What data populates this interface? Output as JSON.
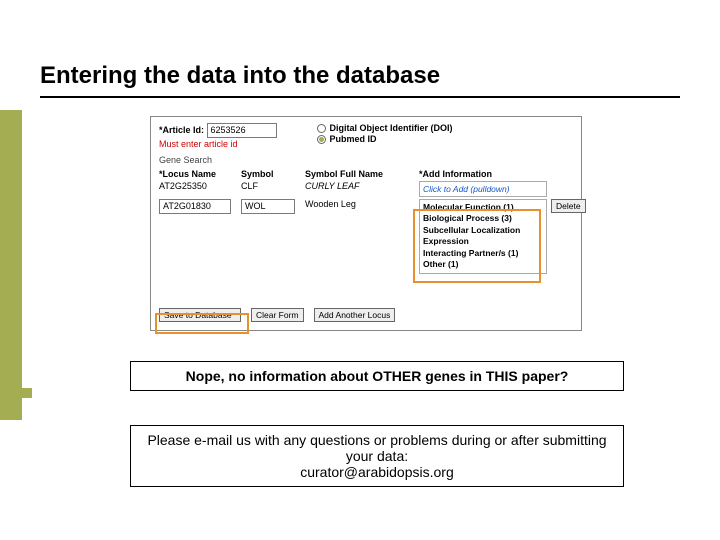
{
  "title": "Entering the data into the database",
  "form": {
    "articleId": {
      "label": "*Article Id:",
      "value": "6253526"
    },
    "errorMsg": "Must enter article id",
    "doi": {
      "label": "Digital Object Identifier (DOI)"
    },
    "pubmed": {
      "label": "Pubmed ID"
    },
    "geneSearch": "Gene Search",
    "cols": {
      "locus": "*Locus Name",
      "symbol": "Symbol",
      "fullname": "Symbol Full Name",
      "addinfo": "*Add Information"
    },
    "row1": {
      "locus": "AT2G25350",
      "symbol": "CLF",
      "fullname": "CURLY LEAF",
      "addLink": "Click to Add (pulldown)"
    },
    "row2": {
      "locus": "AT2G01830",
      "symbol": "WOL",
      "fullname": "Wooden Leg",
      "info": {
        "mf": "Molecular Function (1)",
        "bp": "Biological Process (3)",
        "sl": "Subcellular Localization",
        "ex": "Expression",
        "ip": "Interacting Partner/s (1)",
        "ot": "Other (1)"
      },
      "delete": "Delete"
    },
    "buttons": {
      "save": "Save to Database",
      "clear": "Clear Form",
      "add": "Add Another Locus"
    }
  },
  "note1": "Nope, no information about OTHER genes in THIS paper?",
  "note2a": "Please e-mail us with any questions or problems during or after submitting your data:",
  "note2b": "curator@arabidopsis.org"
}
